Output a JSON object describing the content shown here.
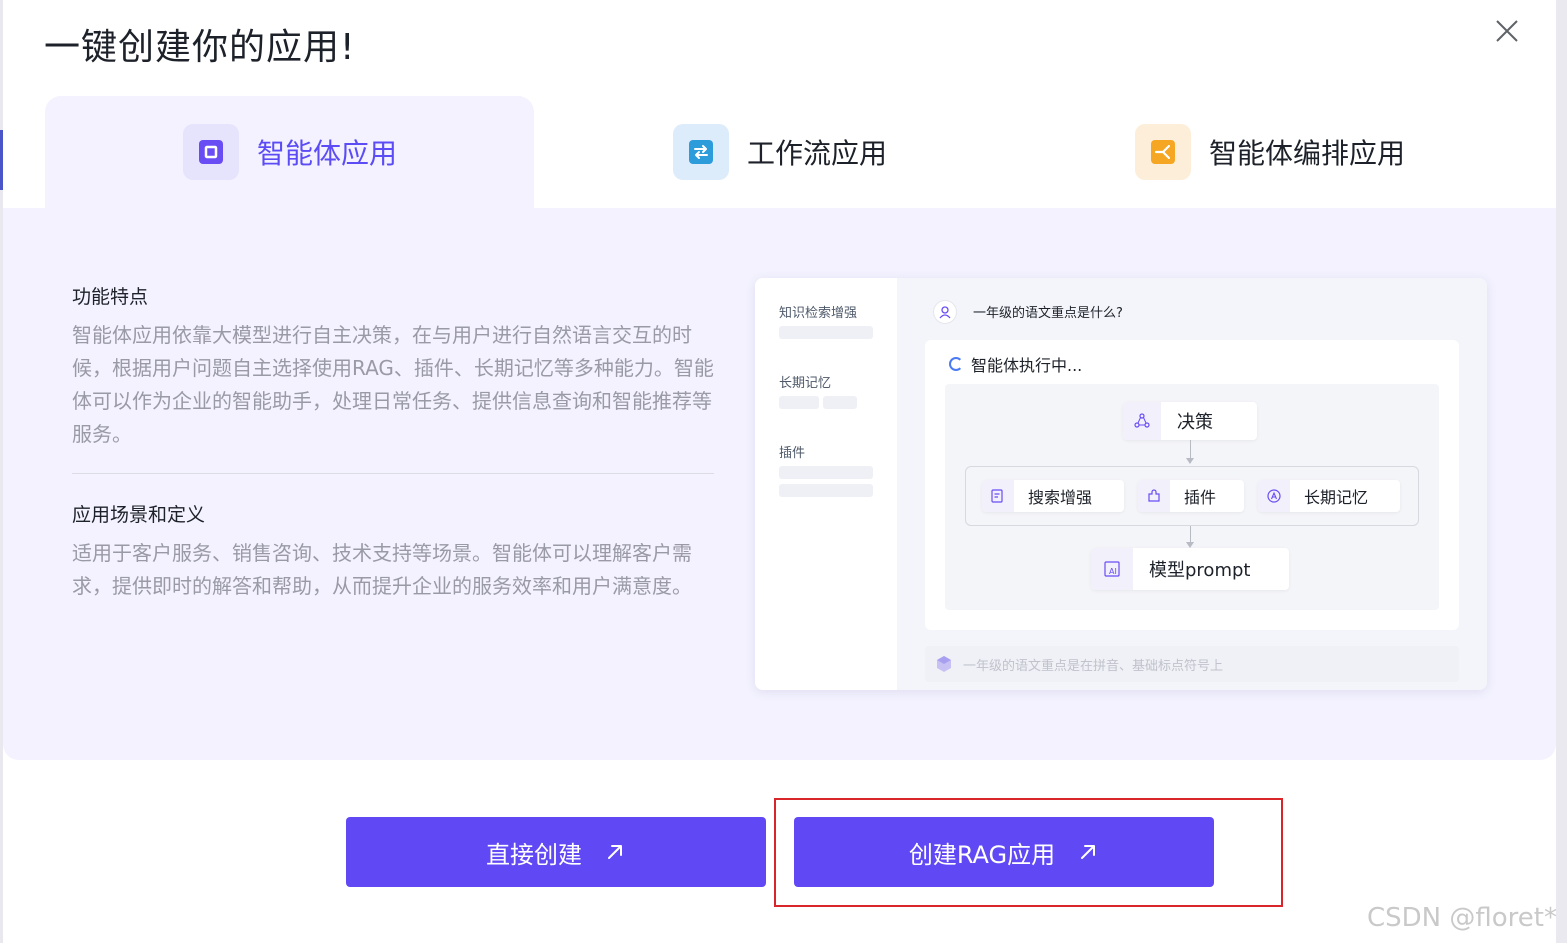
{
  "dialog": {
    "title": "一键创建你的应用!",
    "tabs": [
      {
        "label": "智能体应用",
        "icon": "agent-app-icon",
        "active": true,
        "color": "#5b4cf5"
      },
      {
        "label": "工作流应用",
        "icon": "workflow-app-icon",
        "active": false,
        "color": "#2d9cdb"
      },
      {
        "label": "智能体编排应用",
        "icon": "agent-orchestration-icon",
        "active": false,
        "color": "#f5a623"
      }
    ]
  },
  "features": {
    "title": "功能特点",
    "body": "智能体应用依靠大模型进行自主决策，在与用户进行自然语言交互的时候，根据用户问题自主选择使用RAG、插件、长期记忆等多种能力。智能体可以作为企业的智能助手，处理日常任务、提供信息查询和智能推荐等服务。"
  },
  "scenarios": {
    "title": "应用场景和定义",
    "body": "适用于客户服务、销售咨询、技术支持等场景。智能体可以理解客户需求，提供即时的解答和帮助，从而提升企业的服务效率和用户满意度。"
  },
  "preview": {
    "sidebar": [
      "知识检索增强",
      "长期记忆",
      "插件"
    ],
    "question": "一年级的语文重点是什么?",
    "status": "智能体执行中...",
    "nodes": {
      "decision": "决策",
      "search": "搜索增强",
      "plugin": "插件",
      "memory": "长期记忆",
      "prompt": "模型prompt"
    },
    "answer": "一年级的语文重点是在拼音、基础标点符号上"
  },
  "buttons": {
    "direct": "直接创建",
    "rag": "创建RAG应用"
  },
  "watermark": "CSDN @floret*",
  "colors": {
    "accent": "#6049f5",
    "panel_bg": "#f3f2fe",
    "highlight": "#d9262b"
  }
}
